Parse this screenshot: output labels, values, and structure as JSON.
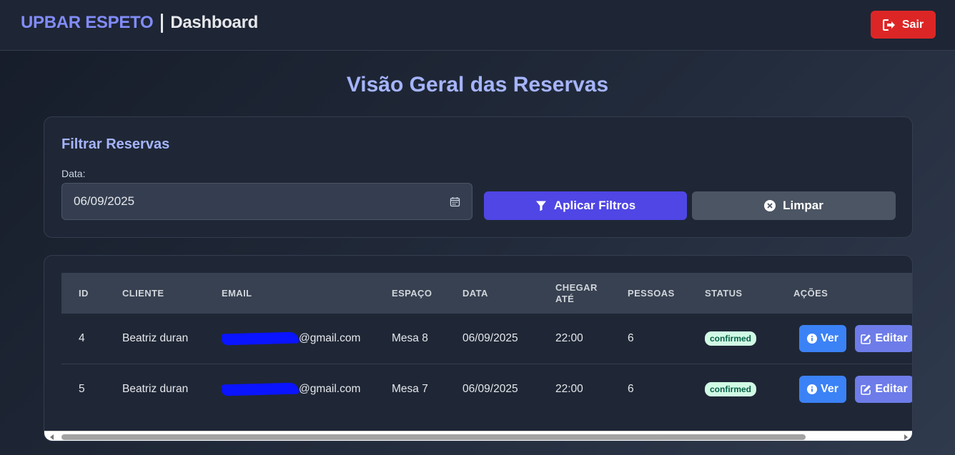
{
  "header": {
    "brand": "UPBAR ESPETO",
    "section": "Dashboard",
    "logout_label": "Sair",
    "logout_icon": "sign-out-icon"
  },
  "page": {
    "title": "Visão Geral das Reservas"
  },
  "filters": {
    "title": "Filtrar Reservas",
    "date_label": "Data:",
    "date_value": "06/09/2025",
    "apply_label": "Aplicar Filtros",
    "clear_label": "Limpar"
  },
  "table": {
    "headers": {
      "id": "ID",
      "client": "CLIENTE",
      "email": "EMAIL",
      "space": "ESPAÇO",
      "date": "DATA",
      "arrive_line1": "CHEGAR",
      "arrive_line2": "ATÉ",
      "people": "PESSOAS",
      "status": "STATUS",
      "actions": "AÇÕES"
    },
    "rows": [
      {
        "id": "4",
        "client": "Beatriz duran",
        "email_suffix": "@gmail.com",
        "space": "Mesa 8",
        "date": "06/09/2025",
        "arrive": "22:00",
        "people": "6",
        "status": "confirmed",
        "view_label": "Ver",
        "edit_label": "Editar"
      },
      {
        "id": "5",
        "client": "Beatriz duran",
        "email_suffix": "@gmail.com",
        "space": "Mesa 7",
        "date": "06/09/2025",
        "arrive": "22:00",
        "people": "6",
        "status": "confirmed",
        "view_label": "Ver",
        "edit_label": "Editar"
      }
    ]
  },
  "colors": {
    "brand": "#818cf8",
    "logout": "#dc2626",
    "apply": "#4f46e5",
    "clear": "#4b5563",
    "view": "#3b82f6",
    "edit": "#6d7ce8",
    "status_confirmed_bg": "#d1fae5"
  }
}
